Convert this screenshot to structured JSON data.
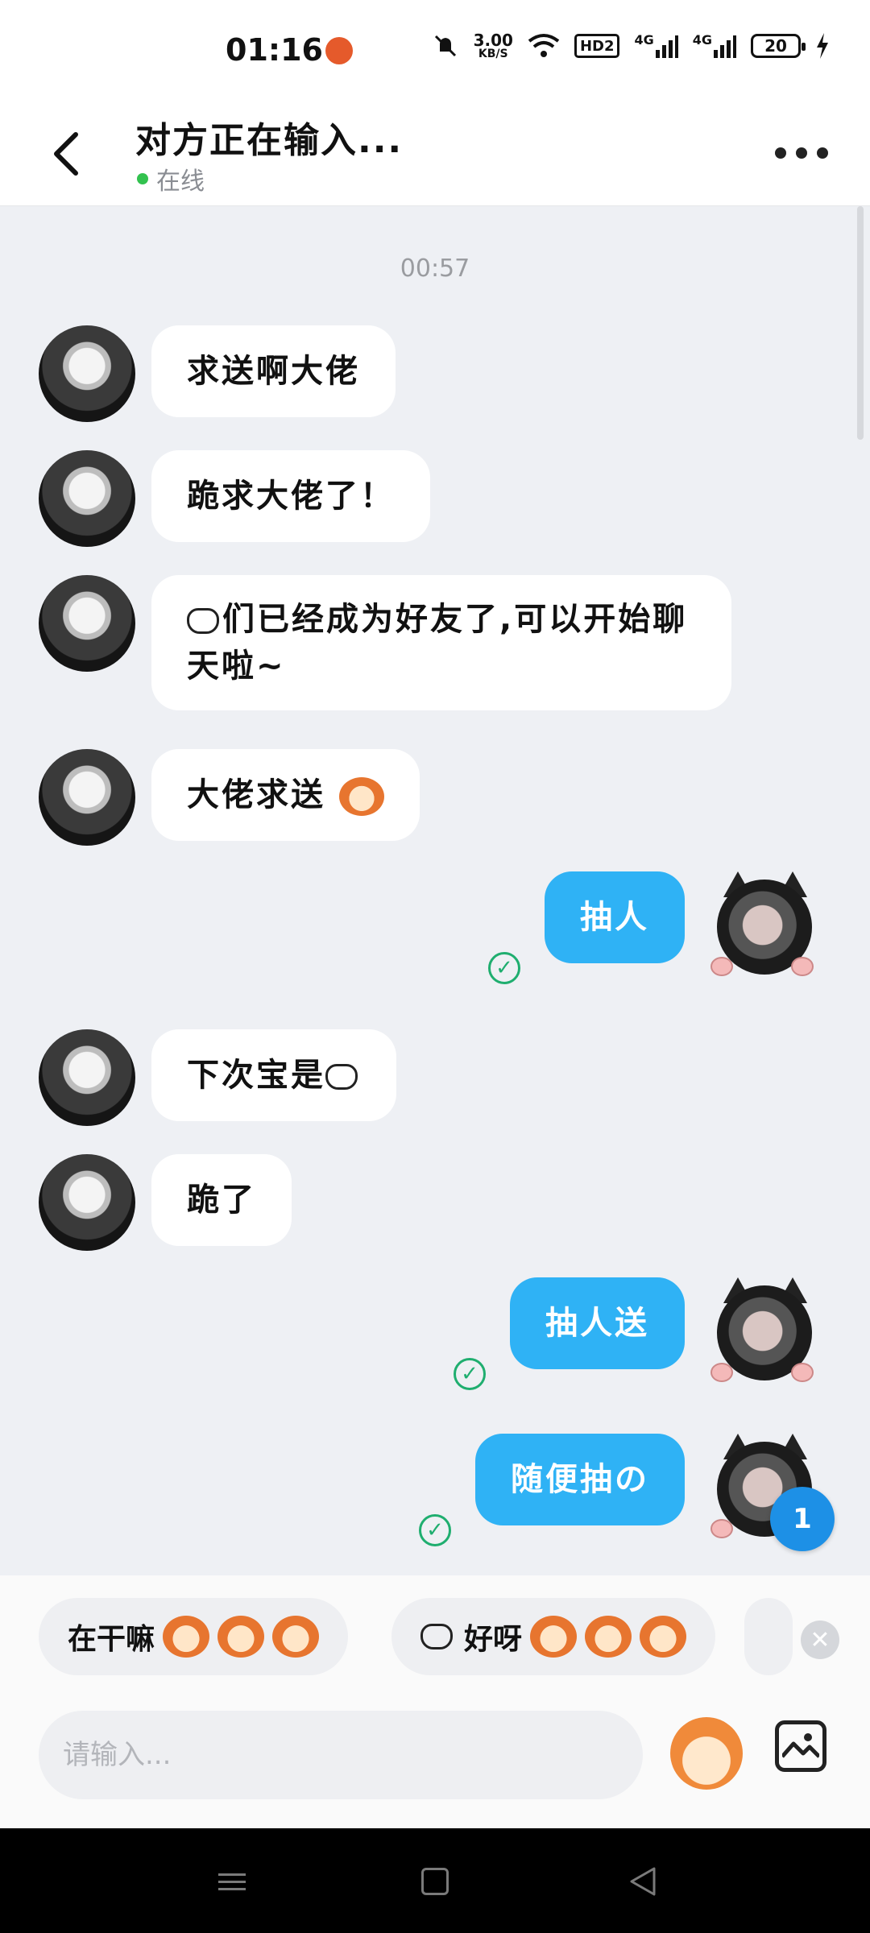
{
  "status_bar": {
    "time": "01:16",
    "net_speed_top": "3.00",
    "net_speed_unit": "KB/S",
    "hd_label": "HD2",
    "signal1_label": "4G",
    "signal2_label": "4G",
    "battery": "20"
  },
  "header": {
    "title": "对方正在输入...",
    "status": "在线"
  },
  "chat": {
    "timestamp": "00:57",
    "messages": [
      {
        "side": "in",
        "text": "求送啊大佬"
      },
      {
        "side": "in",
        "text": "跪求大佬了！"
      },
      {
        "side": "in",
        "text": "们已经成为好友了,可以开始聊天啦~"
      },
      {
        "side": "in",
        "text": "大佬求送"
      },
      {
        "side": "out",
        "text": "抽人"
      },
      {
        "side": "in",
        "text": "下次宝是"
      },
      {
        "side": "in",
        "text": "跪了"
      },
      {
        "side": "out",
        "text": "抽人送"
      },
      {
        "side": "out",
        "text": "随便抽の"
      }
    ],
    "unread_badge": "1"
  },
  "quick_replies": [
    {
      "text": "在干嘛"
    },
    {
      "text": "好呀"
    }
  ],
  "input": {
    "placeholder": "请输入..."
  },
  "icons": {
    "back": "chevron-left-icon",
    "more": "more-dots-icon",
    "read": "check-circle-icon",
    "sticker": "sticker-icon",
    "image": "image-icon"
  },
  "colors": {
    "accent": "#2fb2f5",
    "online": "#33c24f",
    "read_check": "#1fae6f",
    "badge": "#1d90e6"
  }
}
